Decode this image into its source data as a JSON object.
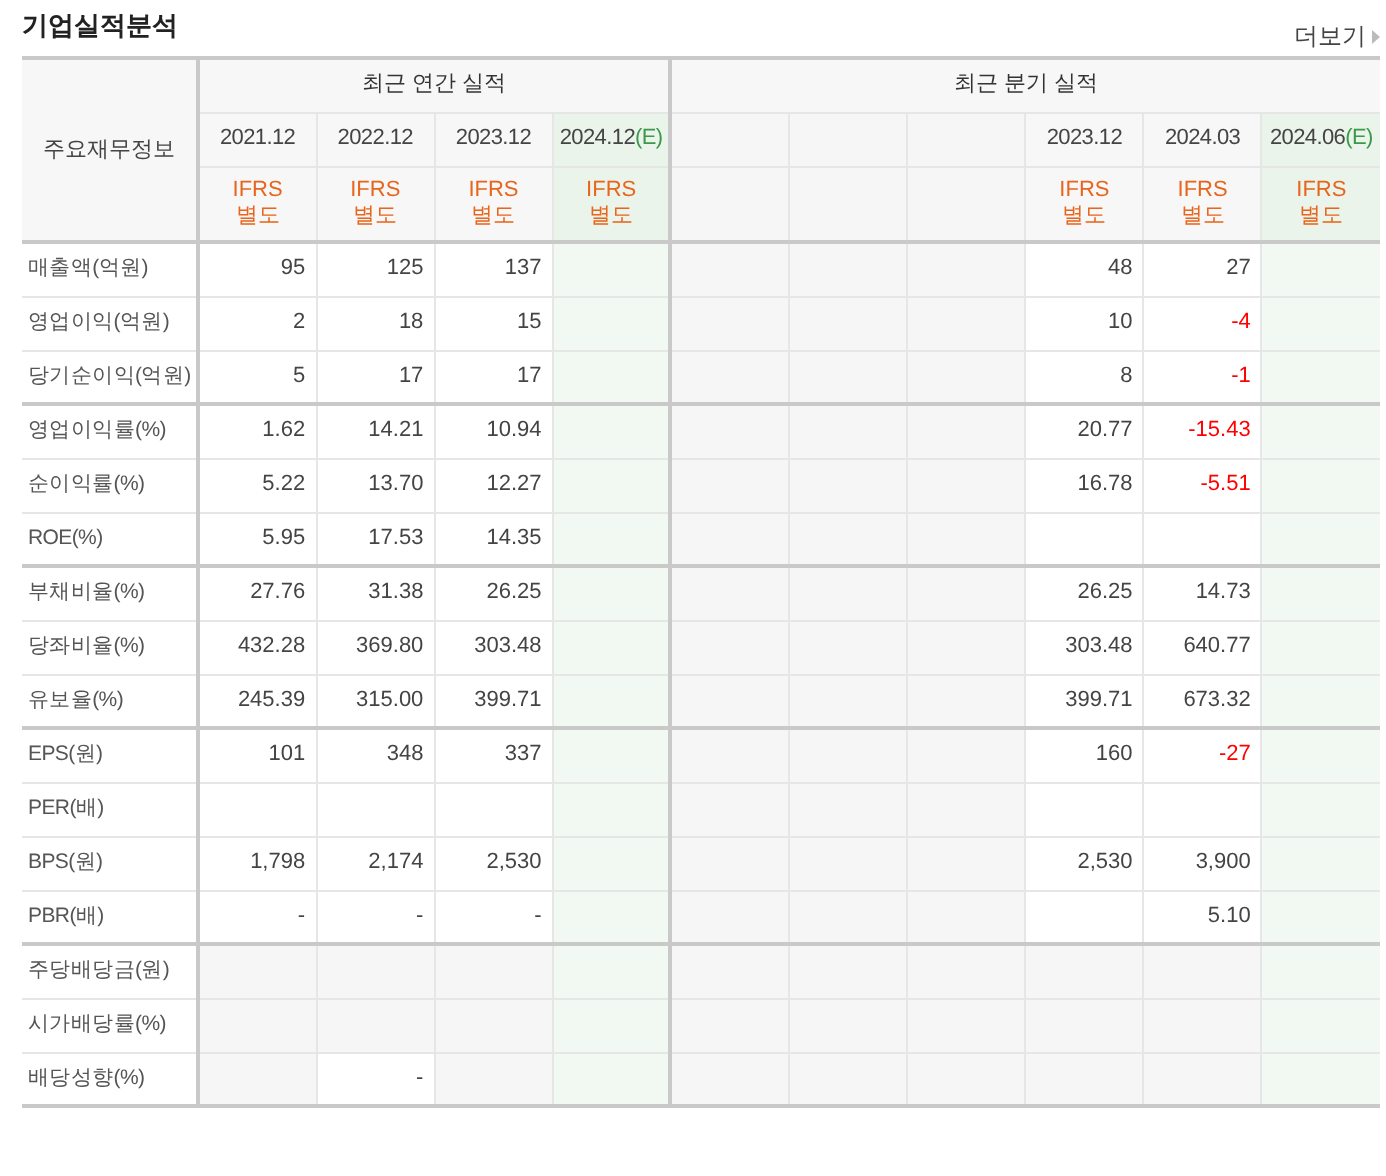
{
  "title": "기업실적분석",
  "more_link": {
    "label": "더보기"
  },
  "table": {
    "header_label": "주요재무정보",
    "column_groups": [
      {
        "label": "최근 연간 실적",
        "columns": [
          {
            "kind": "period",
            "period": "2021.12",
            "estimate": false,
            "basis": "IFRS",
            "scope": "별도"
          },
          {
            "kind": "period",
            "period": "2022.12",
            "estimate": false,
            "basis": "IFRS",
            "scope": "별도"
          },
          {
            "kind": "period",
            "period": "2023.12",
            "estimate": false,
            "basis": "IFRS",
            "scope": "별도"
          },
          {
            "kind": "period",
            "period": "2024.12",
            "suffix": "(E)",
            "estimate": true,
            "basis": "IFRS",
            "scope": "별도"
          }
        ]
      },
      {
        "label": "최근 분기 실적",
        "columns": [
          {
            "kind": "empty"
          },
          {
            "kind": "empty"
          },
          {
            "kind": "empty"
          },
          {
            "kind": "period",
            "period": "2023.12",
            "estimate": false,
            "basis": "IFRS",
            "scope": "별도"
          },
          {
            "kind": "period",
            "period": "2024.03",
            "estimate": false,
            "basis": "IFRS",
            "scope": "별도"
          },
          {
            "kind": "period",
            "period": "2024.06",
            "suffix": "(E)",
            "estimate": true,
            "basis": "IFRS",
            "scope": "별도"
          }
        ]
      }
    ],
    "row_groups": [
      {
        "rows": [
          {
            "label": "매출액(억원)",
            "cells": [
              {
                "kind": "value",
                "value": "95",
                "negative": false
              },
              {
                "kind": "value",
                "value": "125",
                "negative": false
              },
              {
                "kind": "value",
                "value": "137",
                "negative": false
              },
              {
                "kind": "blank"
              },
              {
                "kind": "no-data"
              },
              {
                "kind": "no-data"
              },
              {
                "kind": "no-data"
              },
              {
                "kind": "value",
                "value": "48",
                "negative": false
              },
              {
                "kind": "value",
                "value": "27",
                "negative": false
              },
              {
                "kind": "blank"
              }
            ]
          },
          {
            "label": "영업이익(억원)",
            "cells": [
              {
                "kind": "value",
                "value": "2",
                "negative": false
              },
              {
                "kind": "value",
                "value": "18",
                "negative": false
              },
              {
                "kind": "value",
                "value": "15",
                "negative": false
              },
              {
                "kind": "blank"
              },
              {
                "kind": "no-data"
              },
              {
                "kind": "no-data"
              },
              {
                "kind": "no-data"
              },
              {
                "kind": "value",
                "value": "10",
                "negative": false
              },
              {
                "kind": "value",
                "value": "-4",
                "negative": true
              },
              {
                "kind": "blank"
              }
            ]
          },
          {
            "label": "당기순이익(억원)",
            "cells": [
              {
                "kind": "value",
                "value": "5",
                "negative": false
              },
              {
                "kind": "value",
                "value": "17",
                "negative": false
              },
              {
                "kind": "value",
                "value": "17",
                "negative": false
              },
              {
                "kind": "blank"
              },
              {
                "kind": "no-data"
              },
              {
                "kind": "no-data"
              },
              {
                "kind": "no-data"
              },
              {
                "kind": "value",
                "value": "8",
                "negative": false
              },
              {
                "kind": "value",
                "value": "-1",
                "negative": true
              },
              {
                "kind": "blank"
              }
            ]
          }
        ]
      },
      {
        "rows": [
          {
            "label": "영업이익률(%)",
            "cells": [
              {
                "kind": "value",
                "value": "1.62",
                "negative": false
              },
              {
                "kind": "value",
                "value": "14.21",
                "negative": false
              },
              {
                "kind": "value",
                "value": "10.94",
                "negative": false
              },
              {
                "kind": "blank"
              },
              {
                "kind": "no-data"
              },
              {
                "kind": "no-data"
              },
              {
                "kind": "no-data"
              },
              {
                "kind": "value",
                "value": "20.77",
                "negative": false
              },
              {
                "kind": "value",
                "value": "-15.43",
                "negative": true
              },
              {
                "kind": "blank"
              }
            ]
          },
          {
            "label": "순이익률(%)",
            "cells": [
              {
                "kind": "value",
                "value": "5.22",
                "negative": false
              },
              {
                "kind": "value",
                "value": "13.70",
                "negative": false
              },
              {
                "kind": "value",
                "value": "12.27",
                "negative": false
              },
              {
                "kind": "blank"
              },
              {
                "kind": "no-data"
              },
              {
                "kind": "no-data"
              },
              {
                "kind": "no-data"
              },
              {
                "kind": "value",
                "value": "16.78",
                "negative": false
              },
              {
                "kind": "value",
                "value": "-5.51",
                "negative": true
              },
              {
                "kind": "blank"
              }
            ]
          },
          {
            "label": "ROE(%)",
            "cells": [
              {
                "kind": "value",
                "value": "5.95",
                "negative": false
              },
              {
                "kind": "value",
                "value": "17.53",
                "negative": false
              },
              {
                "kind": "value",
                "value": "14.35",
                "negative": false
              },
              {
                "kind": "blank"
              },
              {
                "kind": "no-data"
              },
              {
                "kind": "no-data"
              },
              {
                "kind": "no-data"
              },
              {
                "kind": "blank"
              },
              {
                "kind": "blank"
              },
              {
                "kind": "blank"
              }
            ]
          }
        ]
      },
      {
        "rows": [
          {
            "label": "부채비율(%)",
            "cells": [
              {
                "kind": "value",
                "value": "27.76",
                "negative": false
              },
              {
                "kind": "value",
                "value": "31.38",
                "negative": false
              },
              {
                "kind": "value",
                "value": "26.25",
                "negative": false
              },
              {
                "kind": "blank"
              },
              {
                "kind": "no-data"
              },
              {
                "kind": "no-data"
              },
              {
                "kind": "no-data"
              },
              {
                "kind": "value",
                "value": "26.25",
                "negative": false
              },
              {
                "kind": "value",
                "value": "14.73",
                "negative": false
              },
              {
                "kind": "blank"
              }
            ]
          },
          {
            "label": "당좌비율(%)",
            "cells": [
              {
                "kind": "value",
                "value": "432.28",
                "negative": false
              },
              {
                "kind": "value",
                "value": "369.80",
                "negative": false
              },
              {
                "kind": "value",
                "value": "303.48",
                "negative": false
              },
              {
                "kind": "blank"
              },
              {
                "kind": "no-data"
              },
              {
                "kind": "no-data"
              },
              {
                "kind": "no-data"
              },
              {
                "kind": "value",
                "value": "303.48",
                "negative": false
              },
              {
                "kind": "value",
                "value": "640.77",
                "negative": false
              },
              {
                "kind": "blank"
              }
            ]
          },
          {
            "label": "유보율(%)",
            "cells": [
              {
                "kind": "value",
                "value": "245.39",
                "negative": false
              },
              {
                "kind": "value",
                "value": "315.00",
                "negative": false
              },
              {
                "kind": "value",
                "value": "399.71",
                "negative": false
              },
              {
                "kind": "blank"
              },
              {
                "kind": "no-data"
              },
              {
                "kind": "no-data"
              },
              {
                "kind": "no-data"
              },
              {
                "kind": "value",
                "value": "399.71",
                "negative": false
              },
              {
                "kind": "value",
                "value": "673.32",
                "negative": false
              },
              {
                "kind": "blank"
              }
            ]
          }
        ]
      },
      {
        "rows": [
          {
            "label": "EPS(원)",
            "cells": [
              {
                "kind": "value",
                "value": "101",
                "negative": false
              },
              {
                "kind": "value",
                "value": "348",
                "negative": false
              },
              {
                "kind": "value",
                "value": "337",
                "negative": false
              },
              {
                "kind": "blank"
              },
              {
                "kind": "no-data"
              },
              {
                "kind": "no-data"
              },
              {
                "kind": "no-data"
              },
              {
                "kind": "value",
                "value": "160",
                "negative": false
              },
              {
                "kind": "value",
                "value": "-27",
                "negative": true
              },
              {
                "kind": "blank"
              }
            ]
          },
          {
            "label": "PER(배)",
            "cells": [
              {
                "kind": "blank"
              },
              {
                "kind": "blank"
              },
              {
                "kind": "blank"
              },
              {
                "kind": "blank"
              },
              {
                "kind": "no-data"
              },
              {
                "kind": "no-data"
              },
              {
                "kind": "no-data"
              },
              {
                "kind": "blank"
              },
              {
                "kind": "blank"
              },
              {
                "kind": "blank"
              }
            ]
          },
          {
            "label": "BPS(원)",
            "cells": [
              {
                "kind": "value",
                "value": "1,798",
                "negative": false
              },
              {
                "kind": "value",
                "value": "2,174",
                "negative": false
              },
              {
                "kind": "value",
                "value": "2,530",
                "negative": false
              },
              {
                "kind": "blank"
              },
              {
                "kind": "no-data"
              },
              {
                "kind": "no-data"
              },
              {
                "kind": "no-data"
              },
              {
                "kind": "value",
                "value": "2,530",
                "negative": false
              },
              {
                "kind": "value",
                "value": "3,900",
                "negative": false
              },
              {
                "kind": "blank"
              }
            ]
          },
          {
            "label": "PBR(배)",
            "cells": [
              {
                "kind": "value",
                "value": "-",
                "negative": false
              },
              {
                "kind": "value",
                "value": "-",
                "negative": false
              },
              {
                "kind": "value",
                "value": "-",
                "negative": false
              },
              {
                "kind": "blank"
              },
              {
                "kind": "no-data"
              },
              {
                "kind": "no-data"
              },
              {
                "kind": "no-data"
              },
              {
                "kind": "blank"
              },
              {
                "kind": "value",
                "value": "5.10",
                "negative": false
              },
              {
                "kind": "blank"
              }
            ]
          }
        ]
      },
      {
        "rows": [
          {
            "label": "주당배당금(원)",
            "cells": [
              {
                "kind": "no-data"
              },
              {
                "kind": "no-data"
              },
              {
                "kind": "no-data"
              },
              {
                "kind": "blank"
              },
              {
                "kind": "no-data"
              },
              {
                "kind": "no-data"
              },
              {
                "kind": "no-data"
              },
              {
                "kind": "no-data"
              },
              {
                "kind": "no-data"
              },
              {
                "kind": "blank"
              }
            ]
          },
          {
            "label": "시가배당률(%)",
            "cells": [
              {
                "kind": "no-data"
              },
              {
                "kind": "no-data"
              },
              {
                "kind": "no-data"
              },
              {
                "kind": "blank"
              },
              {
                "kind": "no-data"
              },
              {
                "kind": "no-data"
              },
              {
                "kind": "no-data"
              },
              {
                "kind": "no-data"
              },
              {
                "kind": "no-data"
              },
              {
                "kind": "blank"
              }
            ]
          },
          {
            "label": "배당성향(%)",
            "cells": [
              {
                "kind": "no-data"
              },
              {
                "kind": "value",
                "value": "-",
                "negative": false
              },
              {
                "kind": "no-data"
              },
              {
                "kind": "blank"
              },
              {
                "kind": "no-data"
              },
              {
                "kind": "no-data"
              },
              {
                "kind": "no-data"
              },
              {
                "kind": "no-data"
              },
              {
                "kind": "no-data"
              },
              {
                "kind": "blank"
              }
            ]
          }
        ]
      }
    ]
  }
}
